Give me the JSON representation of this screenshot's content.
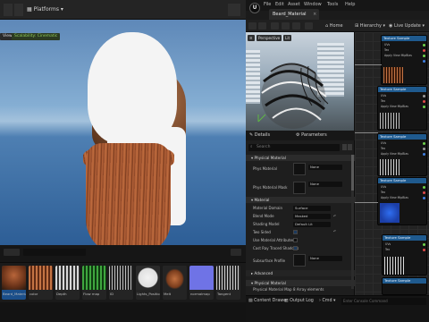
{
  "app": {
    "menu": [
      "File",
      "Edit",
      "Asset",
      "Window",
      "Tools",
      "Help"
    ],
    "material_tab": "Beard_Material"
  },
  "left_toolbar": {
    "platforms_label": "Platforms"
  },
  "material_toolbar": {
    "home_label": "Home",
    "hierarchy_label": "Hierarchy",
    "live_update_label": "Live Update"
  },
  "viewport": {
    "view_chip": "View",
    "scalability_chip": "Scalability: Cinematic"
  },
  "content_browser": {
    "assets": [
      {
        "label": "Beard_Material",
        "selected": true
      },
      {
        "label": "color"
      },
      {
        "label": "Depth"
      },
      {
        "label": "Flow map"
      },
      {
        "label": "ID"
      },
      {
        "label": "Lights_Position"
      },
      {
        "label": "Melt"
      },
      {
        "label": "normalmap"
      },
      {
        "label": "Tangent"
      }
    ]
  },
  "preview": {
    "perspective_chip": "Perspective",
    "lit_chip": "Lit"
  },
  "details": {
    "tab_details": "Details",
    "tab_parameters": "Parameters",
    "search_placeholder": "Search",
    "sections": {
      "physical_material": "Physical Material",
      "material": "Material",
      "advanced": "Advanced",
      "physical_material_2": "Physical Material"
    },
    "props": {
      "phys_material": "Phys Material",
      "phys_material_val": "None",
      "phys_material_mask": "Phys Material Mask",
      "phys_material_mask_val": "None",
      "material_domain": "Material Domain",
      "material_domain_val": "Surface",
      "blend_mode": "Blend Mode",
      "blend_mode_val": "Masked",
      "shading_model": "Shading Model",
      "shading_model_val": "Default Lit",
      "two_sided": "Two Sided",
      "use_material_attributes": "Use Material Attributes",
      "cast_ray_traced_shadows": "Cast Ray Traced Shadows",
      "subsurface_profile": "Subsurface Profile",
      "subsurface_profile_val": "None",
      "physical_material_map": "Physical Material Map",
      "physical_material_map_val": "8 Array elements"
    }
  },
  "graph": {
    "nodes": [
      {
        "title": "Texture Sample"
      },
      {
        "title": "Texture Sample"
      },
      {
        "title": "Texture Sample"
      },
      {
        "title": "Texture Sample"
      },
      {
        "title": "Texture Sample"
      },
      {
        "title": "Texture Sample"
      }
    ],
    "pin_labels": {
      "uvs": "UVs",
      "tex": "Tex",
      "apply_view_mipbias": "Apply View MipBias",
      "rgb": "RGB",
      "r": "R",
      "g": "G",
      "b": "B",
      "a": "A",
      "rgba": "RGBA"
    }
  },
  "statusbar": {
    "content_drawer": "Content Drawer",
    "output_log": "Output Log",
    "cmd": "Cmd",
    "console_placeholder": "Enter Console Command"
  },
  "colors": {
    "accent": "#1f5a8e",
    "pin_green": "#6fd34a",
    "pin_red": "#e34a4a",
    "pin_blue": "#3f7fe0",
    "pin_gray": "#9a9a9a"
  }
}
